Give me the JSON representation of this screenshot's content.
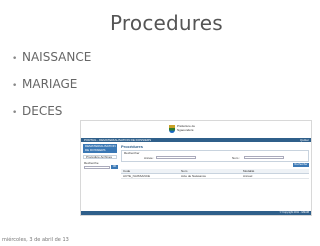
{
  "slide": {
    "title": "Procedures",
    "bullets": [
      {
        "label": "NAISSANCE"
      },
      {
        "label": "MARIAGE"
      },
      {
        "label": "DECES"
      }
    ],
    "bullet_glyph": "•",
    "footer_date": "miércoles, 3 de abril de 13"
  },
  "app": {
    "logo_text_line1": "Préfecture de",
    "logo_text_line2": "Ngaoundéré",
    "topbar_title": "PORTAIL - DEMATERIALISATION DE DOSSIERS",
    "topbar_right": "Quitter",
    "sidebar": {
      "active_label": "DEMATERIALISATION DE DOSSIERS",
      "item_label": "Procédure Archives",
      "search_label": "Recherche",
      "search_button": "OK"
    },
    "main": {
      "title": "Procédures",
      "search_legend": "Rechercher",
      "annee_label": "Année :",
      "nom_label": "Nom :",
      "search_button": "Rechercher",
      "columns": [
        "Code",
        "Nom",
        "Modalité"
      ],
      "rows": [
        [
          "ACTE_NAISSANCE",
          "Acte de Naissance",
          "Annuel"
        ]
      ]
    },
    "footer_copyright": "© Copyright 2011 - GMAM"
  },
  "colors": {
    "bar": "#2f5f8a",
    "accent": "#3a78b5",
    "title": "#555555",
    "bullet_text": "#666666"
  }
}
